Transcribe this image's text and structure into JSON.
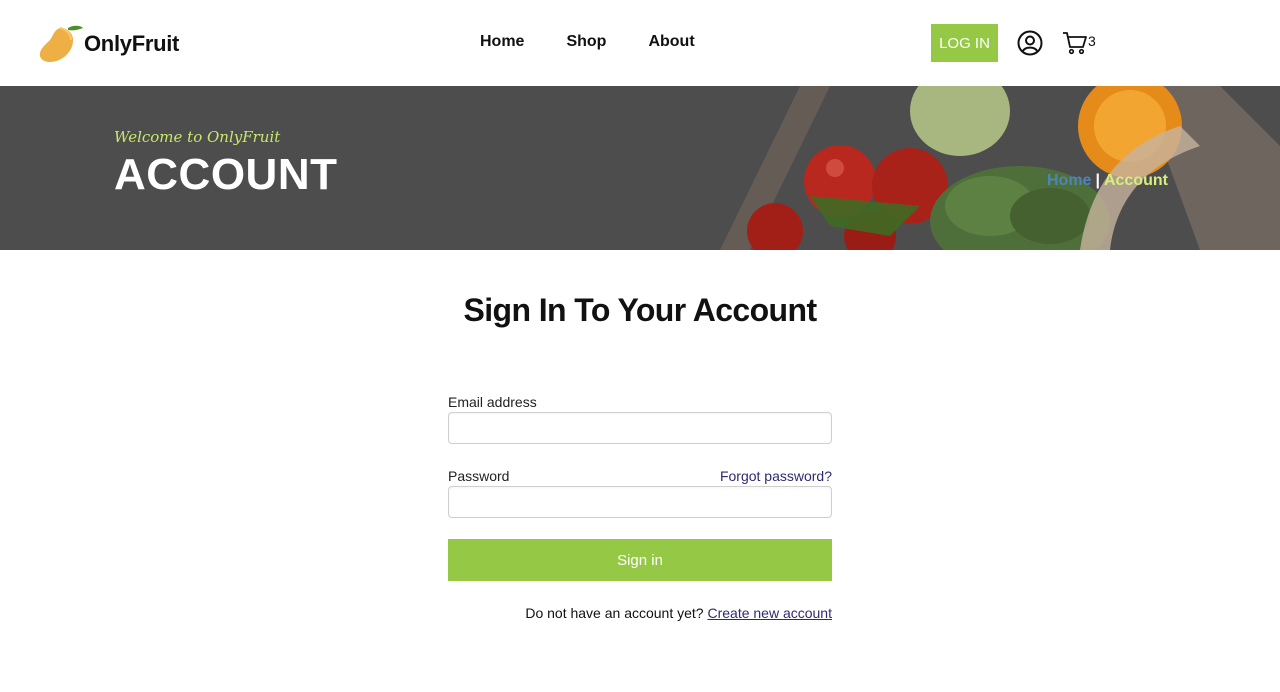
{
  "header": {
    "logo_text": "OnlyFruit",
    "nav": [
      {
        "label": "Home"
      },
      {
        "label": "Shop"
      },
      {
        "label": "About"
      }
    ],
    "login_label": "LOG IN",
    "cart_count": "3",
    "icons": [
      "mango-logo-icon",
      "user-icon",
      "cart-icon"
    ]
  },
  "banner": {
    "welcome": "Welcome to OnlyFruit",
    "title": "ACCOUNT",
    "breadcrumb": {
      "home": "Home",
      "separator": "|",
      "current": "Account"
    }
  },
  "main": {
    "heading": "Sign In To Your Account",
    "email_label": "Email address",
    "email_value": "",
    "password_label": "Password",
    "password_value": "",
    "forgot_label": "Forgot password?",
    "signin_label": "Sign in",
    "create_prompt": "Do not have an account yet?",
    "create_link": "Create new account"
  },
  "colors": {
    "accent": "#95c945",
    "banner_bg": "#4d4d4d",
    "welcome": "#c8e86a",
    "breadcrumb_home": "#4a86b8",
    "breadcrumb_current": "#d7ee7a",
    "link": "#2e2a72"
  }
}
